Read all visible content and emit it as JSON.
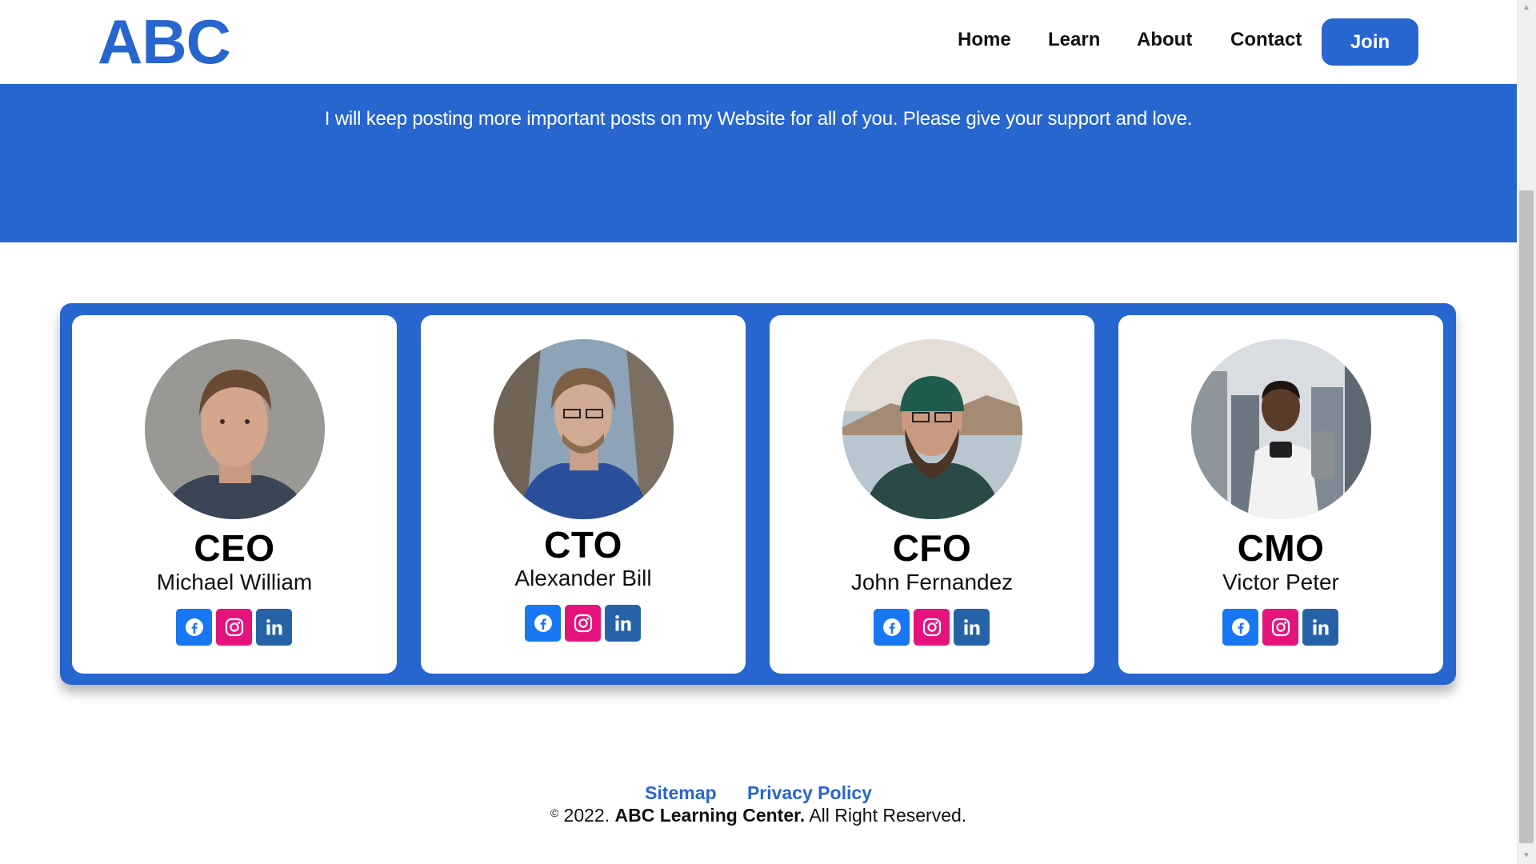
{
  "colors": {
    "brand": "#2765cf",
    "facebook": "#1877f2",
    "instagram": "#e4147c",
    "linkedin": "#2563a6"
  },
  "header": {
    "logo": "ABC",
    "nav": [
      "Home",
      "Learn",
      "About",
      "Contact"
    ],
    "join_label": "Join"
  },
  "banner": {
    "text": "I will keep posting more important posts on my Website for all of you. Please give your support and love."
  },
  "team": [
    {
      "role": "CEO",
      "name": "Michael William",
      "icons": [
        "facebook-icon",
        "instagram-icon",
        "linkedin-icon"
      ]
    },
    {
      "role": "CTO",
      "name": "Alexander Bill",
      "icons": [
        "facebook-icon",
        "instagram-icon",
        "linkedin-icon"
      ]
    },
    {
      "role": "CFO",
      "name": "John Fernandez",
      "icons": [
        "facebook-icon",
        "instagram-icon",
        "linkedin-icon"
      ]
    },
    {
      "role": "CMO",
      "name": "Victor Peter",
      "icons": [
        "facebook-icon",
        "instagram-icon",
        "linkedin-icon"
      ]
    }
  ],
  "footer": {
    "links": [
      "Sitemap",
      "Privacy Policy"
    ],
    "copyright_symbol": "©",
    "copyright_year": "2022.",
    "company": "ABC Learning Center.",
    "rights": "All Right Reserved."
  }
}
